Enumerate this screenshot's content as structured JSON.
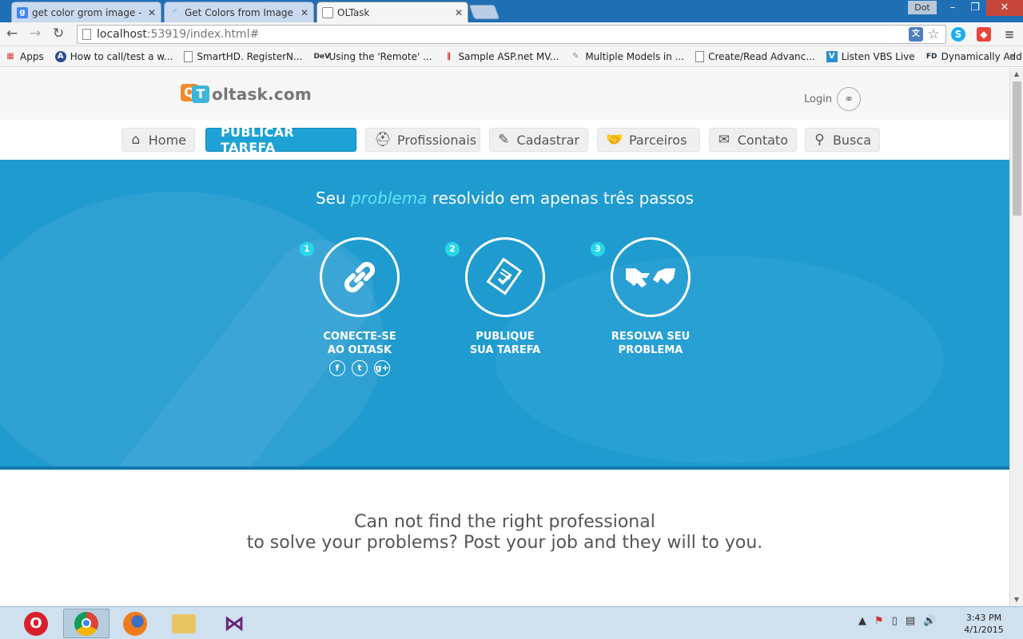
{
  "browser": {
    "tabs": [
      {
        "title": "get color grom image - G",
        "icon": "google-icon",
        "icon_color": "#4285f4"
      },
      {
        "title": "Get Colors from Image",
        "icon": "loading-icon",
        "icon_color": "#4a7fc1"
      },
      {
        "title": "OLTask",
        "icon": "page-icon",
        "icon_color": "#888888"
      }
    ],
    "user_badge": "Dot",
    "address": {
      "host": "localhost",
      "rest": ":53919/index.html#"
    },
    "bookmarks": [
      {
        "label": "Apps",
        "icon": "apps-grid-icon"
      },
      {
        "label": "How to call/test a w...",
        "icon": "question-icon"
      },
      {
        "label": "SmartHD. RegisterN...",
        "icon": "page-icon"
      },
      {
        "label": "Using the 'Remote' ...",
        "icon": "dev-icon"
      },
      {
        "label": "Sample ASP.net MV...",
        "icon": "bars-icon"
      },
      {
        "label": "Multiple Models in ...",
        "icon": "puzzle-icon"
      },
      {
        "label": "Create/Read Advanc...",
        "icon": "page-icon"
      },
      {
        "label": "Listen VBS Live",
        "icon": "v-icon"
      },
      {
        "label": "Dynamically Add an...",
        "icon": "fd-icon"
      }
    ]
  },
  "site": {
    "logo_text": "oltask.com",
    "login_label": "Login",
    "nav": [
      {
        "label": "Home",
        "icon": "home-icon"
      },
      {
        "label": "PUBLICAR TAREFA",
        "icon": ""
      },
      {
        "label": "Profissionais",
        "icon": "helmet-icon"
      },
      {
        "label": "Cadastrar",
        "icon": "edit-icon"
      },
      {
        "label": "Parceiros",
        "icon": "handshake-icon"
      },
      {
        "label": "Contato",
        "icon": "envelope-icon"
      },
      {
        "label": "Busca",
        "icon": "search-icon"
      }
    ],
    "hero": {
      "title_before": "Seu ",
      "title_highlight": "problema",
      "title_after": " resolvido em apenas três passos",
      "steps": [
        {
          "num": "1",
          "line1": "CONECTE-SE",
          "line2": "AO OLTASK",
          "icon": "link-icon"
        },
        {
          "num": "2",
          "line1": "PUBLIQUE",
          "line2": "SUA TAREFA",
          "icon": "document-check-icon"
        },
        {
          "num": "3",
          "line1": "RESOLVA SEU",
          "line2": "PROBLEMA",
          "icon": "handshake-icon"
        }
      ],
      "socials": [
        "f",
        "t",
        "g+"
      ]
    },
    "promo": {
      "line1": "Can not find the right professional",
      "line2": "to solve your problems? Post your job and they will to you."
    }
  },
  "taskbar": {
    "apps": [
      "opera-icon",
      "chrome-icon",
      "firefox-icon",
      "folder-icon",
      "visual-studio-icon"
    ],
    "time": "3:43 PM",
    "date": "4/1/2015"
  },
  "colors": {
    "hero_blue": "#1f9bd0",
    "cta_blue": "#1ea2d5",
    "highlight_cyan": "#5de6f5",
    "step_badge": "#28d7e9",
    "logo_orange": "#f08b2c",
    "logo_blue": "#3db4d9"
  }
}
